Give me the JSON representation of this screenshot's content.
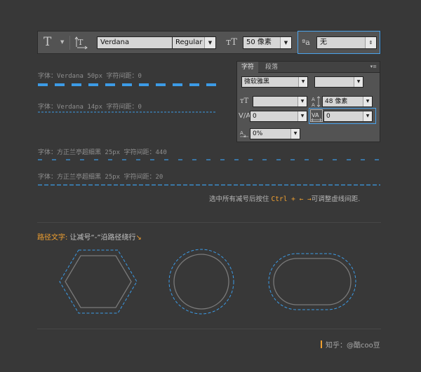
{
  "optionbar": {
    "font_family": "Verdana",
    "font_style": "Regular",
    "font_size": "50 像素",
    "antialias": "无"
  },
  "samples": [
    {
      "label": "字体：Verdana  50px  字符间距：0"
    },
    {
      "label": "字体：Verdana  14px  字符间距：0"
    },
    {
      "label": "字体：方正兰亭超细黑  25px  字符间距：440"
    },
    {
      "label": "字体：方正兰亭超细黑  25px  字符间距：20"
    }
  ],
  "char_panel": {
    "tab_character": "字符",
    "tab_paragraph": "段落",
    "font_family": "微软雅黑",
    "font_style": "",
    "font_size": "",
    "leading": "48 像素",
    "kerning": "0",
    "tracking": "0",
    "scale": "0%"
  },
  "hint": {
    "before": "选中所有减号后按住 ",
    "key": "Ctrl + ← →",
    "after": "可调整虚线间距."
  },
  "path_section": {
    "title_accent": "路径文字:",
    "title_rest": " 让减号“-”沿路径绕行",
    "title_arrow": "↘"
  },
  "credit": {
    "text": "知乎：@酷coo豆"
  },
  "colors": {
    "dash_blue": "#3c9be6",
    "accent_orange": "#f0a030",
    "highlight_blue": "#4aa3ec"
  }
}
